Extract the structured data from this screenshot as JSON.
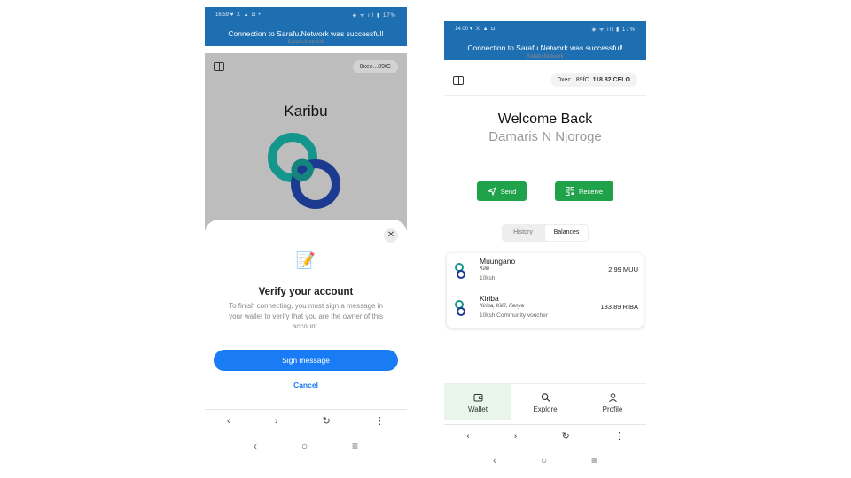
{
  "phone1": {
    "status": {
      "time": "16:59",
      "icons": "♥ X ▲ ◘ •",
      "right": "◈ ᯤ ıll ▮ 17%"
    },
    "banner": "Connection to Sarafu.Network was successful!",
    "peek": "Sarafu.Network",
    "header": {
      "address": "0xec...89fC"
    },
    "heading": "Karibu",
    "dialog": {
      "icon": "📝",
      "title": "Verify your account",
      "text": "To finish connecting, you must sign a message in your wallet to verify that you are the owner of this account.",
      "sign_label": "Sign message",
      "cancel_label": "Cancel",
      "close_glyph": "✕"
    },
    "browser": {
      "back": "‹",
      "forward": "›",
      "reload": "↻",
      "menu": "⋮"
    },
    "sysnav": {
      "back": "‹",
      "home": "○",
      "recents": "≡"
    }
  },
  "phone2": {
    "status": {
      "time": "14:00",
      "icons": "♥ X ▲ ◘",
      "right": "◈ ᯤ ıll ▮ 17%"
    },
    "banner": "Connection to Sarafu.Network was successful!",
    "peek": "Sarafu.Network",
    "header": {
      "address": "0xec...89fC",
      "balance": "118.82 CELO"
    },
    "welcome": "Welcome Back",
    "user_name": "Damaris N Njoroge",
    "actions": {
      "send_label": "Send",
      "receive_label": "Receive"
    },
    "tabs": [
      "History",
      "Balances"
    ],
    "vouchers": [
      {
        "name": "Muungano",
        "location": "Kilifi",
        "description": "10ksh",
        "balance": "2.99 MUU"
      },
      {
        "name": "Kiriba",
        "location": "Kiriba, Kilifi, Kenya",
        "description": "10ksh Community voucher",
        "balance": "133.89 RIBA"
      }
    ],
    "bottom_nav": [
      {
        "label": "Wallet",
        "icon": "wallet-icon"
      },
      {
        "label": "Explore",
        "icon": "search-icon"
      },
      {
        "label": "Profile",
        "icon": "user-icon"
      }
    ],
    "browser": {
      "back": "‹",
      "forward": "›",
      "reload": "↻",
      "menu": "⋮"
    },
    "sysnav": {
      "back": "‹",
      "home": "○",
      "recents": "≡"
    }
  },
  "colors": {
    "banner": "#1e6fb2",
    "primary_blue": "#1a7cf4",
    "green": "#1fa24a",
    "logo_teal": "#14968c",
    "logo_navy": "#1c3a8f"
  }
}
